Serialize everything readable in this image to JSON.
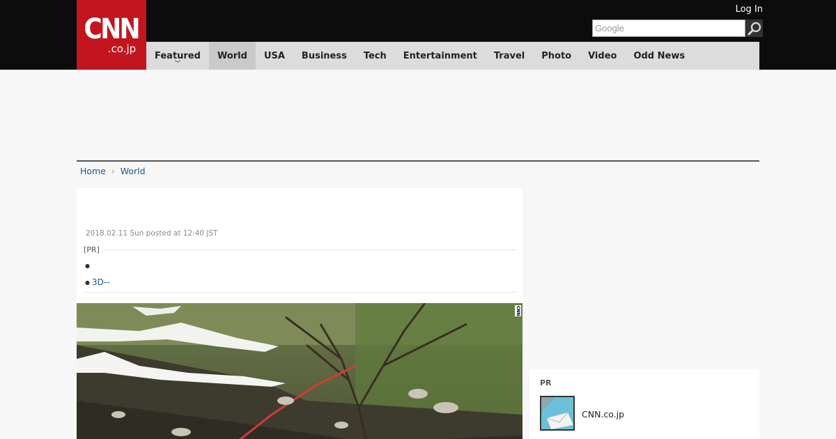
{
  "header": {
    "logo_mark": "CNN",
    "logo_sub": ".co.jp",
    "login_label": "Log In",
    "search_placeholder": "Google"
  },
  "nav": {
    "items": [
      {
        "label": "Featured"
      },
      {
        "label": "World"
      },
      {
        "label": "USA"
      },
      {
        "label": "Business"
      },
      {
        "label": "Tech"
      },
      {
        "label": "Entertainment"
      },
      {
        "label": "Travel"
      },
      {
        "label": "Photo"
      },
      {
        "label": "Video"
      },
      {
        "label": "Odd News"
      }
    ],
    "active": "World"
  },
  "breadcrumb": {
    "home": "Home",
    "section": "World"
  },
  "article": {
    "date": "2018.02.11 Sun posted at 12:40 JST",
    "pr_label": "[PR]",
    "pr_links": [
      "",
      "3D--"
    ],
    "image_watermark": "CNN"
  },
  "sidebar": {
    "pr_title": "PR",
    "pr_item_name": "CNN.co.jp"
  },
  "colors": {
    "brand_red": "#c2151d",
    "top_bar": "#0c0c0c",
    "nav_bg": "#dcdcdc",
    "link": "#1a5a8a"
  }
}
